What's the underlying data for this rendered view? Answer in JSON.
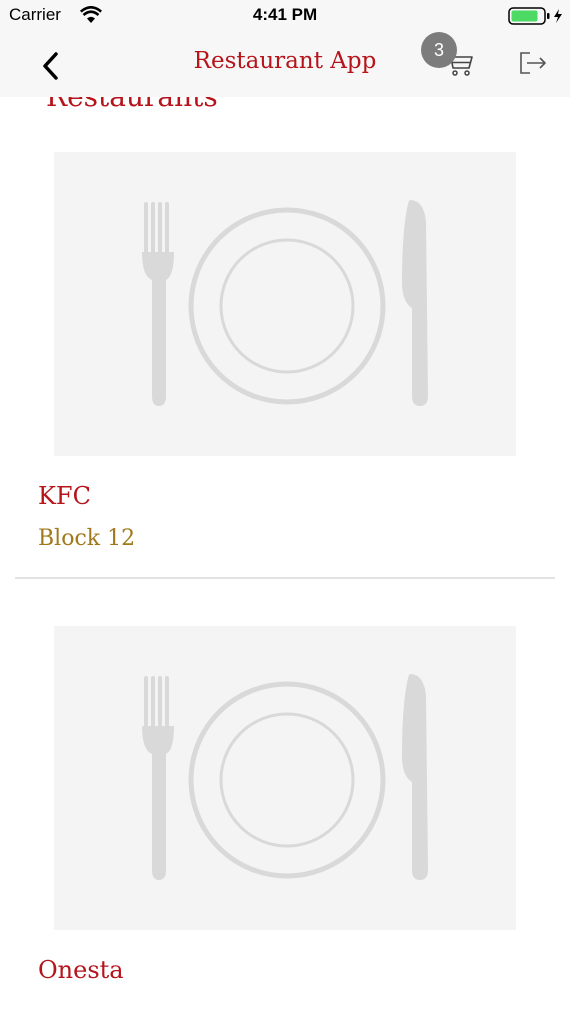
{
  "status_bar": {
    "carrier": "Carrier",
    "time": "4:41 PM",
    "wifi_icon": "wifi-icon",
    "battery_icon": "battery-charging-icon"
  },
  "nav": {
    "title": "Restaurant App",
    "back_icon": "chevron-left-icon",
    "cart_icon": "cart-icon",
    "cart_count": "3",
    "logout_icon": "logout-icon"
  },
  "section_heading": "Restaurants",
  "restaurants": [
    {
      "name": "KFC",
      "address": "Block 12",
      "image_icon": "plate-cutlery-icon"
    },
    {
      "name": "Onesta",
      "address": "",
      "image_icon": "plate-cutlery-icon"
    }
  ],
  "colors": {
    "primary": "#b5141b",
    "secondary": "#a0791b",
    "nav_background": "#f7f7f7",
    "placeholder_background": "#f4f4f4",
    "placeholder_icon": "#d9d9d9",
    "badge": "#7c7c7c"
  }
}
